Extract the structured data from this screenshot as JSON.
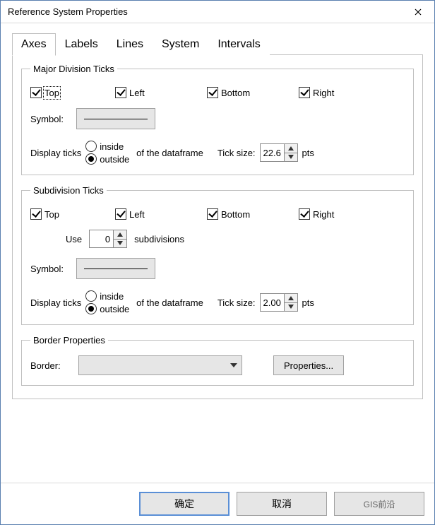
{
  "window": {
    "title": "Reference System Properties"
  },
  "tabs": {
    "axes": "Axes",
    "labels": "Labels",
    "lines": "Lines",
    "system": "System",
    "intervals": "Intervals"
  },
  "major": {
    "legend": "Major Division Ticks",
    "top": "Top",
    "left": "Left",
    "bottom": "Bottom",
    "right": "Right",
    "symbol_label": "Symbol:",
    "display_ticks": "Display ticks",
    "inside": "inside",
    "outside": "outside",
    "of_frame": "of the dataframe",
    "tick_size_label": "Tick size:",
    "tick_size_value": "22.6",
    "pts": "pts"
  },
  "sub": {
    "legend": "Subdivision Ticks",
    "top": "Top",
    "left": "Left",
    "bottom": "Bottom",
    "right": "Right",
    "use": "Use",
    "subdiv_value": "0",
    "subdivisions": "subdivisions",
    "symbol_label": "Symbol:",
    "display_ticks": "Display ticks",
    "inside": "inside",
    "outside": "outside",
    "of_frame": "of the dataframe",
    "tick_size_label": "Tick size:",
    "tick_size_value": "2.00",
    "pts": "pts"
  },
  "border": {
    "legend": "Border Properties",
    "label": "Border:",
    "properties_btn": "Properties..."
  },
  "footer": {
    "ok": "确定",
    "cancel": "取消",
    "apply": "GIS前沿"
  }
}
